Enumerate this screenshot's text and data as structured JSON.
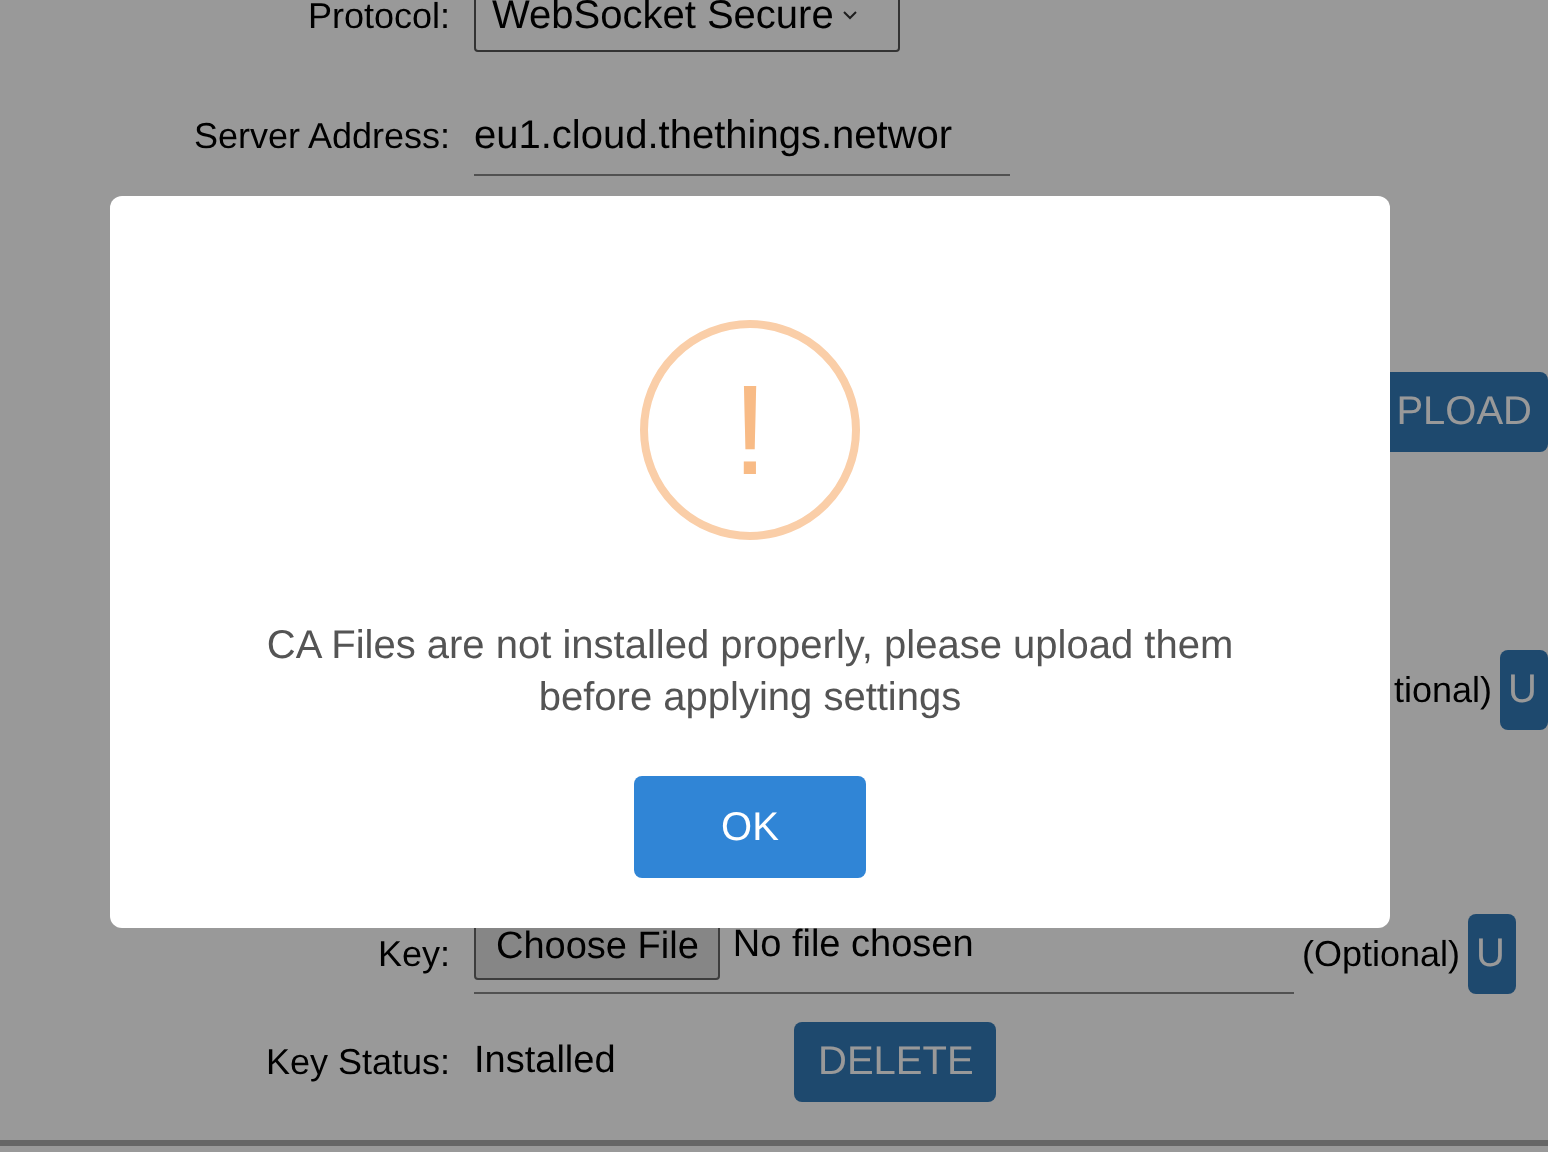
{
  "form": {
    "rows": [
      {
        "kind": "select",
        "label": "Protocol:",
        "value": "WebSocket Secure"
      },
      {
        "kind": "text",
        "label": "Server Address:",
        "value": "eu1.cloud.thethings.networ"
      },
      {
        "kind": "upload",
        "button": "PLOAD"
      },
      {
        "kind": "partial",
        "note": "tional)",
        "button": "U"
      },
      {
        "kind": "file",
        "label": "Key:",
        "choose": "Choose File",
        "file": "No file chosen",
        "note": "(Optional)",
        "button": "U"
      },
      {
        "kind": "status",
        "label": "Key Status:",
        "value": "Installed",
        "button": "DELETE"
      }
    ]
  },
  "dialog": {
    "icon": "!",
    "message": "CA Files are not installed properly, please upload them before applying settings",
    "button": "OK"
  }
}
